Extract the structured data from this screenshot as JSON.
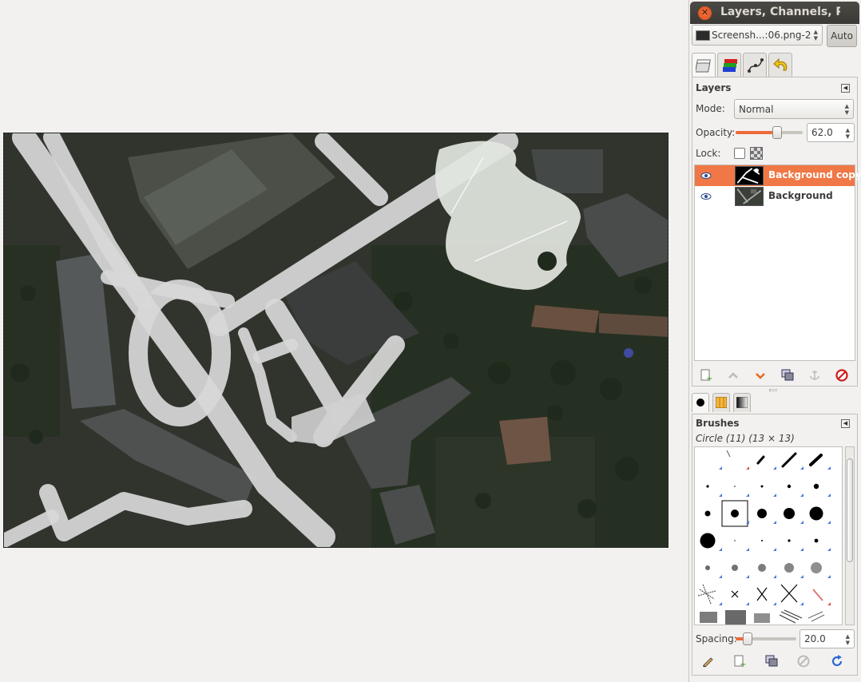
{
  "dock": {
    "title": "Layers, Channels, Pa",
    "image_selector": "Screensh...:06.png-2",
    "auto_button": "Auto"
  },
  "layers": {
    "panel_title": "Layers",
    "mode_label": "Mode:",
    "mode_value": "Normal",
    "opacity_label": "Opacity:",
    "opacity_value": "62.0",
    "opacity_fraction": 0.62,
    "lock_label": "Lock:",
    "items": [
      {
        "name": "Background copy",
        "visible": true,
        "selected": true
      },
      {
        "name": "Background",
        "visible": true,
        "selected": false
      }
    ]
  },
  "brushes": {
    "panel_title": "Brushes",
    "current_brush": "Circle (11) (13 × 13)",
    "spacing_label": "Spacing:",
    "spacing_value": "20.0",
    "spacing_fraction": 0.2
  },
  "colors": {
    "accent": "#f07746",
    "titlebar": "#3c3b37"
  },
  "icons": {
    "close": "close-icon",
    "visibility": "eye-icon",
    "new_layer": "new-layer-icon",
    "raise": "raise-layer-icon",
    "lower": "lower-layer-icon",
    "duplicate": "duplicate-layer-icon",
    "anchor": "anchor-icon",
    "delete": "delete-icon"
  }
}
